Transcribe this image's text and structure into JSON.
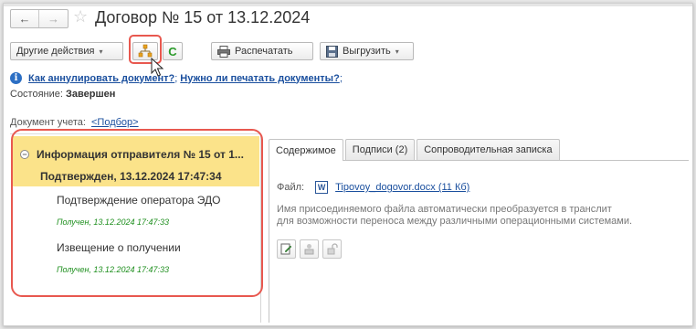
{
  "header": {
    "title": "Договор № 15 от 13.12.2024",
    "back_icon": "←",
    "forward_icon": "→",
    "star_icon": "☆"
  },
  "toolbar": {
    "other_actions_label": "Другие действия",
    "refresh_icon": "C",
    "print_label": "Распечатать",
    "export_label": "Выгрузить",
    "caret": "▾"
  },
  "info": {
    "icon": "i",
    "link1": "Как аннулировать документ?",
    "link2": "Нужно ли печатать документы?",
    "sep1": ";",
    "sep2": ";"
  },
  "status": {
    "label": "Состояние:",
    "value": "Завершен"
  },
  "doc_account": {
    "label": "Документ учета:",
    "value": "<Подбор>"
  },
  "tree": {
    "collapse_icon": "−",
    "title": "Информация отправителя № 15 от 1...",
    "subtitle": "Подтвержден, 13.12.2024 17:47:34",
    "items": [
      {
        "label": "Подтверждение оператора ЭДО",
        "status": "Получен, 13.12.2024 17:47:33"
      },
      {
        "label": "Извещение о получении",
        "status": "Получен, 13.12.2024 17:47:33"
      }
    ]
  },
  "tabs": [
    {
      "label": "Содержимое",
      "active": true
    },
    {
      "label": "Подписи (2)",
      "active": false
    },
    {
      "label": "Сопроводительная записка",
      "active": false
    }
  ],
  "content": {
    "file_label": "Файл:",
    "word_icon": "W",
    "file_link": "Tipovoy_dogovor.docx (11 Кб)",
    "note_line1": "Имя присоединяемого файла автоматически преобразуется в транслит",
    "note_line2": "для возможности переноса между различными операционными системами."
  },
  "colors": {
    "highlight": "#e8584f",
    "tree_selected": "#fbe38a",
    "link": "#1a4f9e",
    "status_green": "#1e8f1e"
  }
}
